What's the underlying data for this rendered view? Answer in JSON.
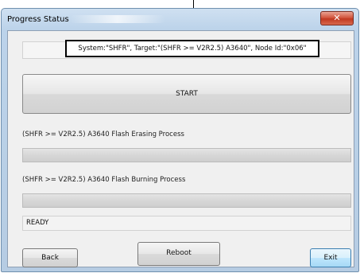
{
  "window": {
    "title": "Progress Status",
    "close_glyph": "✕"
  },
  "info": {
    "text": "System:\"SHFR\", Target:\"(SHFR >= V2R2.5) A3640\", Node Id:\"0x06\""
  },
  "start_button": {
    "label": "START"
  },
  "erase": {
    "label": "(SHFR >= V2R2.5) A3640 Flash Erasing Process",
    "progress": 0
  },
  "burn": {
    "label": "(SHFR >= V2R2.5) A3640 Flash Burning Process",
    "progress": 0
  },
  "status": {
    "text": "READY"
  },
  "buttons": {
    "back": "Back",
    "reboot": "Reboot",
    "exit": "Exit"
  },
  "colors": {
    "progress_fill": "#06b025",
    "close_button": "#c13a22"
  }
}
